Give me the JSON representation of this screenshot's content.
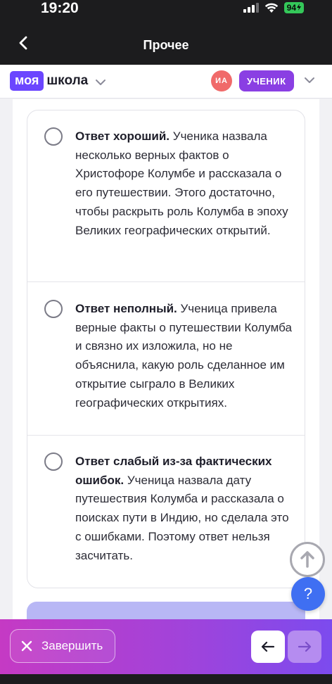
{
  "status_bar": {
    "time": "19:20",
    "battery": "94"
  },
  "nav": {
    "title": "Прочее"
  },
  "header": {
    "logo_part1": "моя",
    "logo_part2": "школа",
    "avatar_initials": "ИА",
    "role": "УЧЕНИК",
    "colors": {
      "logo": "#6b46ff",
      "role": "#8a3fe3",
      "avatar": "#f06a6a"
    }
  },
  "options": [
    {
      "bold": "Ответ хороший.",
      "text": " Ученика назвала несколько верных фактов о Христофоре Колумбе и рассказала о его путешествии. Этого достаточно, чтобы раскрыть роль Колумба в эпоху Великих географических открытий."
    },
    {
      "bold": "Ответ неполный.",
      "text": " Ученица привела верные факты о путешествии Колумба и связно их изложила, но не объяснила, какую роль сделанное им открытие сыграло в Великих географических открытиях."
    },
    {
      "bold": "Ответ слабый из-за фактических ошибок.",
      "text": " Ученица назвала дату путешествия Колумба и рассказала о поисках пути в Индию, но сделала это с ошибками. Поэтому ответ нельзя засчитать."
    }
  ],
  "help_label": "?",
  "bottom_bar": {
    "finish_label": "Завершить"
  }
}
